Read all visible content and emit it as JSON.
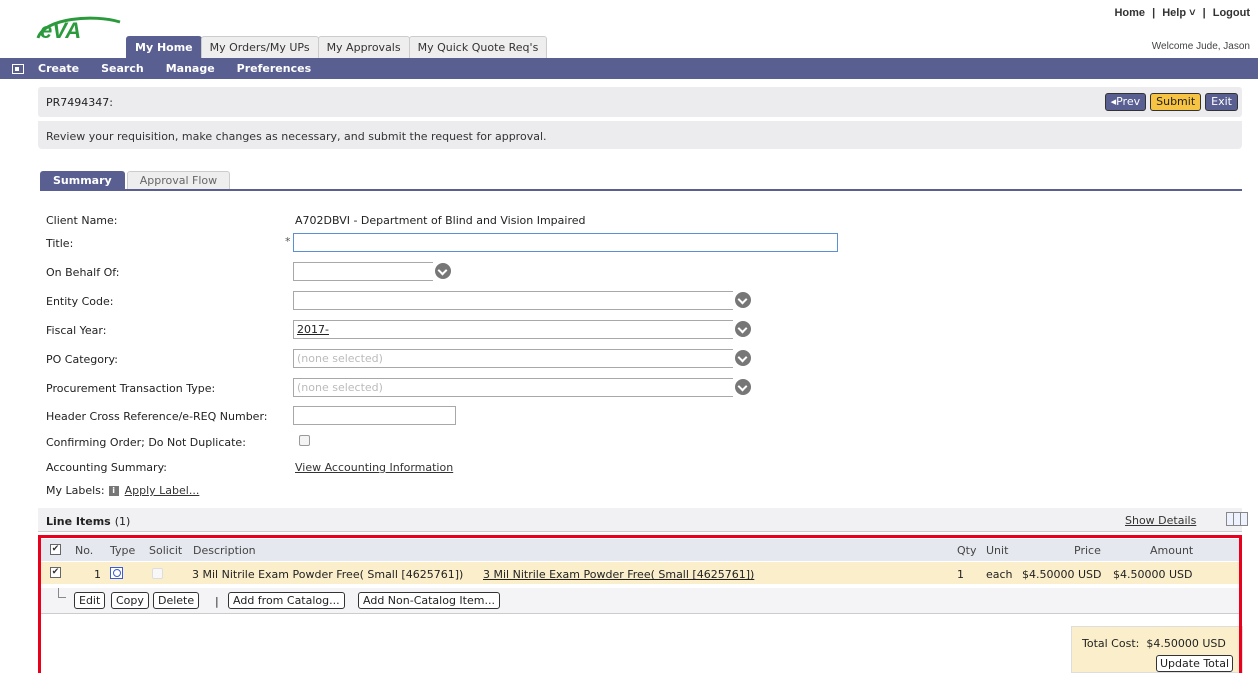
{
  "header": {
    "logo_text": "eVA",
    "links": [
      "Home",
      "|",
      "Help ˅",
      "|",
      "Logout"
    ],
    "welcome": "Welcome Jude, Jason",
    "tabs": [
      "My Home",
      "My Orders/My UPs",
      "My Approvals",
      "My Quick Quote Req's"
    ]
  },
  "nav": {
    "items": [
      "Create",
      "Search",
      "Manage",
      "Preferences"
    ]
  },
  "pr": {
    "id": "PR7494347:",
    "prev": "◂Prev",
    "submit": "Submit",
    "exit": "Exit",
    "info": "Review your requisition, make changes as necessary, and submit the request for approval."
  },
  "subtabs": [
    "Summary",
    "Approval Flow"
  ],
  "form": {
    "client_name_label": "Client Name:",
    "client_name_value": "A702DBVI - Department of Blind and Vision Impaired",
    "title_label": "Title:",
    "title_required": "*",
    "title_value": "",
    "on_behalf_label": "On Behalf Of:",
    "entity_code_label": "Entity Code:",
    "fiscal_year_label": "Fiscal Year:",
    "fiscal_year_value": "2017-",
    "po_category_label": "PO Category:",
    "po_category_value": "(none selected)",
    "ptt_label": "Procurement Transaction Type:",
    "ptt_value": "(none selected)",
    "hcr_label": "Header Cross Reference/e-REQ Number:",
    "confirming_label": "Confirming Order; Do Not Duplicate:",
    "accounting_label": "Accounting Summary:",
    "accounting_link": "View Accounting Information",
    "labels_label": "My Labels:",
    "apply_label": "Apply Label..."
  },
  "line_items": {
    "title": "Line Items",
    "count": "(1)",
    "show_details": "Show Details",
    "columns": [
      "No.",
      "Type",
      "Solicit",
      "Description",
      "Qty",
      "Unit",
      "Price",
      "Amount"
    ],
    "rows": [
      {
        "no": "1",
        "description": "3 Mil Nitrile Exam Powder Free( Small [4625761])",
        "description_link": "3 Mil Nitrile Exam Powder Free( Small [4625761])",
        "qty": "1",
        "unit": "each",
        "price": "$4.50000 USD",
        "amount": "$4.50000 USD"
      }
    ],
    "buttons": {
      "edit": "Edit",
      "copy": "Copy",
      "delete": "Delete",
      "separator": "|",
      "add_catalog": "Add from Catalog...",
      "add_noncatalog": "Add Non-Catalog Item..."
    },
    "total_label": "Total Cost:",
    "total_value": "$4.50000 USD",
    "update_total": "Update Total"
  },
  "colors": {
    "nav_purple": "#5a5f92",
    "highlight_red": "#e8001c",
    "row_yellow": "#fbefcb",
    "button_gold": "#f6c343"
  }
}
